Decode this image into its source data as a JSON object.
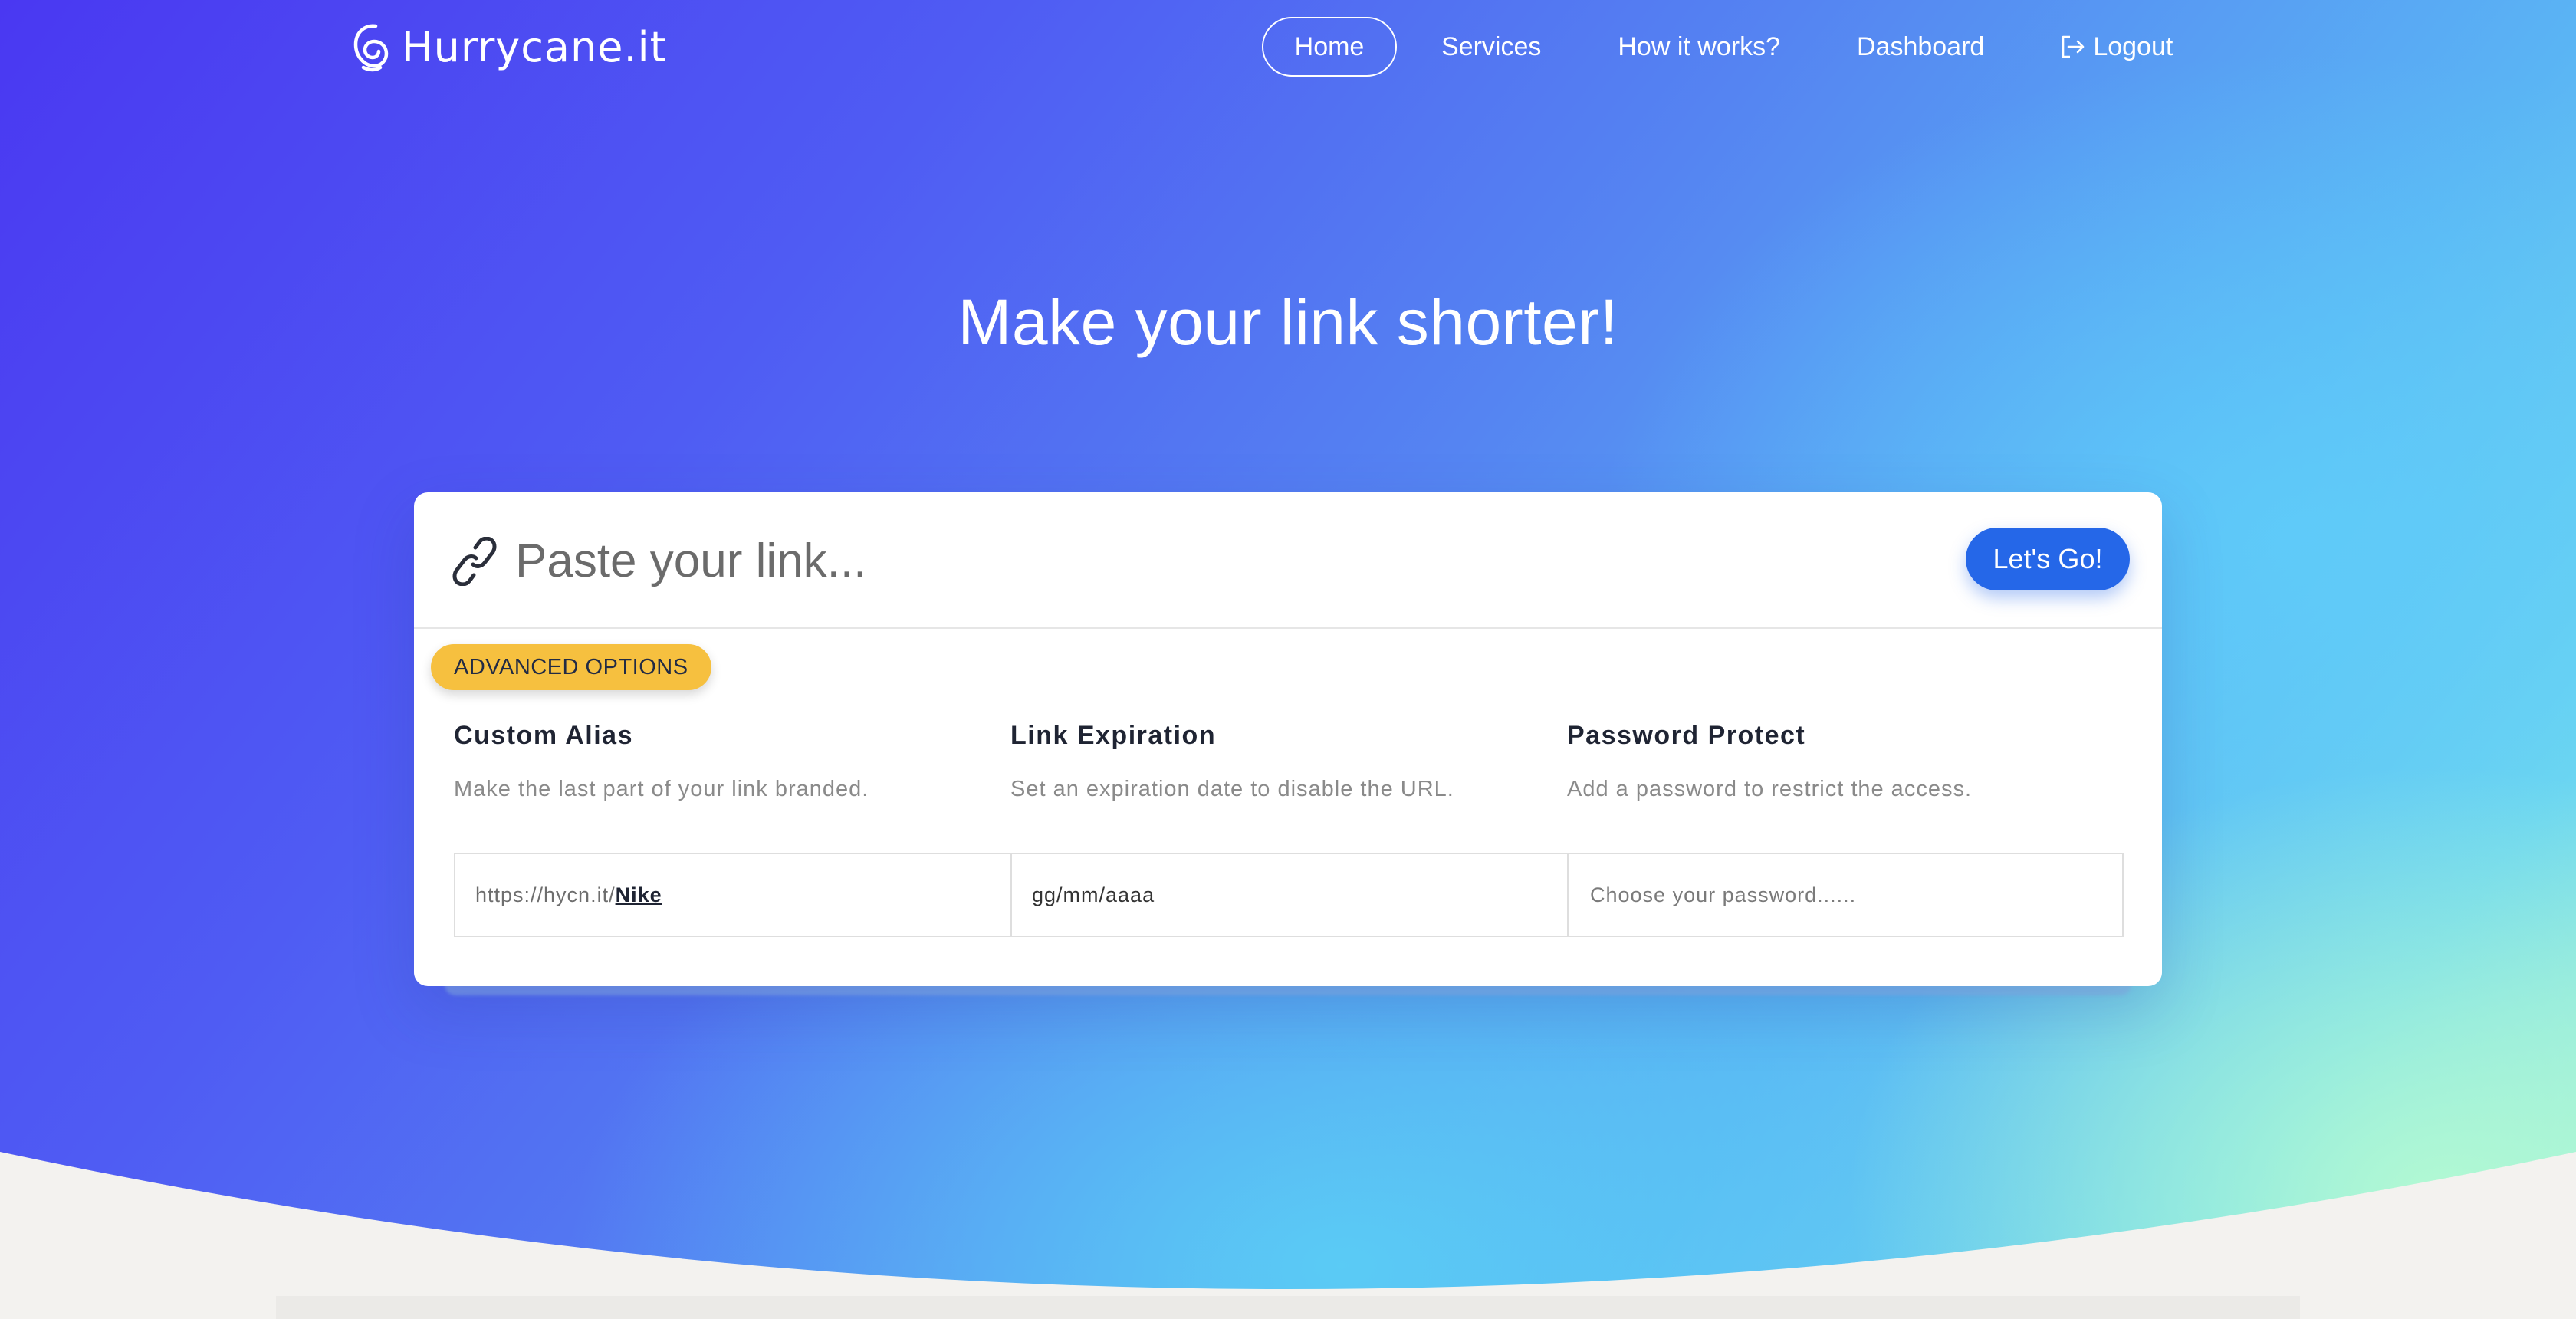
{
  "brand": {
    "name": "Hurrycane.it",
    "logo_icon": "spiral-icon"
  },
  "nav": {
    "items": [
      {
        "label": "Home",
        "active": true
      },
      {
        "label": "Services",
        "active": false
      },
      {
        "label": "How it works?",
        "active": false
      },
      {
        "label": "Dashboard",
        "active": false
      },
      {
        "label": "Logout",
        "active": false,
        "icon": "logout-icon"
      }
    ]
  },
  "hero": {
    "headline": "Make your link shorter!"
  },
  "shortener": {
    "link_placeholder": "Paste your link...",
    "link_icon": "link-icon",
    "submit_label": "Let's Go!",
    "advanced_label": "ADVANCED OPTIONS",
    "options": [
      {
        "title": "Custom Alias",
        "description": "Make the last part of your link branded.",
        "prefix": "https://hycn.it/",
        "value": "Nike"
      },
      {
        "title": "Link Expiration",
        "description": "Set an expiration date to disable the URL.",
        "value": "gg/mm/aaaa"
      },
      {
        "title": "Password Protect",
        "description": "Add a password to restrict the access.",
        "placeholder": "Choose your password......"
      }
    ]
  },
  "colors": {
    "primary_button": "#2567e8",
    "advanced_badge": "#f6c03f",
    "gradient_start": "#4a38f2",
    "gradient_end": "#a7f2d8"
  }
}
